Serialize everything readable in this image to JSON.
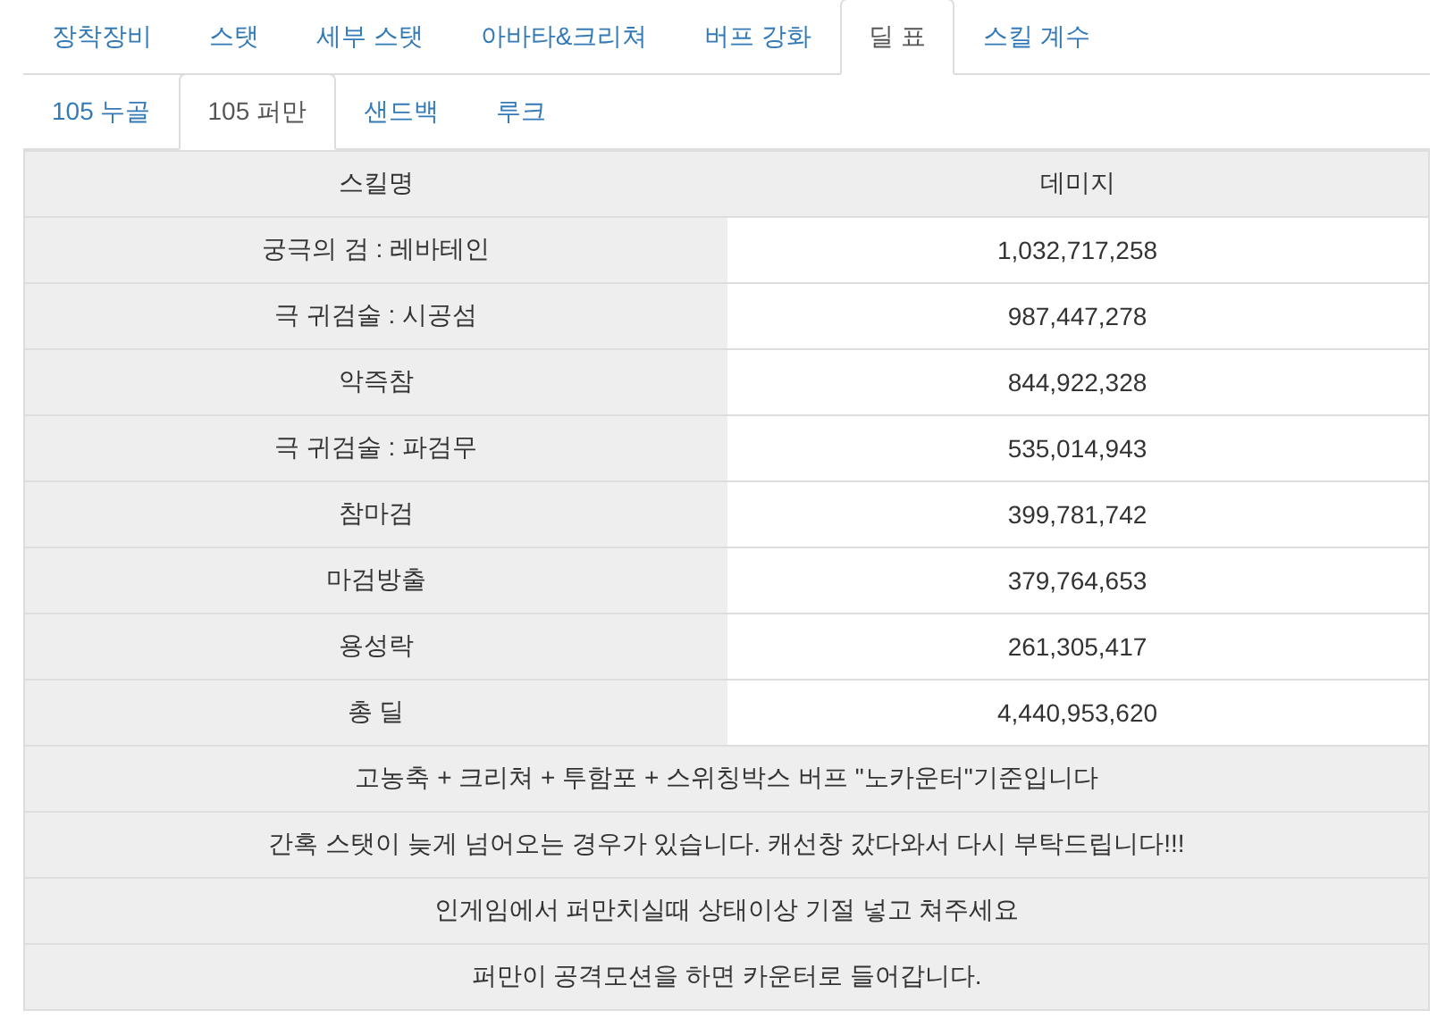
{
  "main_tabs": [
    {
      "label": "장착장비",
      "selected": false
    },
    {
      "label": "스탯",
      "selected": false
    },
    {
      "label": "세부 스탯",
      "selected": false
    },
    {
      "label": "아바타&크리쳐",
      "selected": false
    },
    {
      "label": "버프 강화",
      "selected": false
    },
    {
      "label": "딜 표",
      "selected": true
    },
    {
      "label": "스킬 계수",
      "selected": false
    }
  ],
  "sub_tabs": [
    {
      "label": "105 누골",
      "selected": false
    },
    {
      "label": "105 퍼만",
      "selected": true
    },
    {
      "label": "샌드백",
      "selected": false
    },
    {
      "label": "루크",
      "selected": false
    }
  ],
  "table": {
    "columns": [
      "스킬명",
      "데미지"
    ],
    "rows": [
      {
        "skill": "궁극의 검 : 레바테인",
        "damage": "1,032,717,258"
      },
      {
        "skill": "극 귀검술 : 시공섬",
        "damage": "987,447,278"
      },
      {
        "skill": "악즉참",
        "damage": "844,922,328"
      },
      {
        "skill": "극 귀검술 : 파검무",
        "damage": "535,014,943"
      },
      {
        "skill": "참마검",
        "damage": "399,781,742"
      },
      {
        "skill": "마검방출",
        "damage": "379,764,653"
      },
      {
        "skill": "용성락",
        "damage": "261,305,417"
      },
      {
        "skill": "총 딜",
        "damage": "4,440,953,620"
      }
    ],
    "notes": [
      "고농축 + 크리쳐 + 투함포 + 스위칭박스 버프 \"노카운터\"기준입니다",
      "간혹 스탯이 늦게 넘어오는 경우가 있습니다. 캐선창 갔다와서 다시 부탁드립니다!!!",
      "인게임에서 퍼만치실때 상태이상 기절 넣고 쳐주세요",
      "퍼만이 공격모션을 하면 카운터로 들어갑니다."
    ]
  }
}
